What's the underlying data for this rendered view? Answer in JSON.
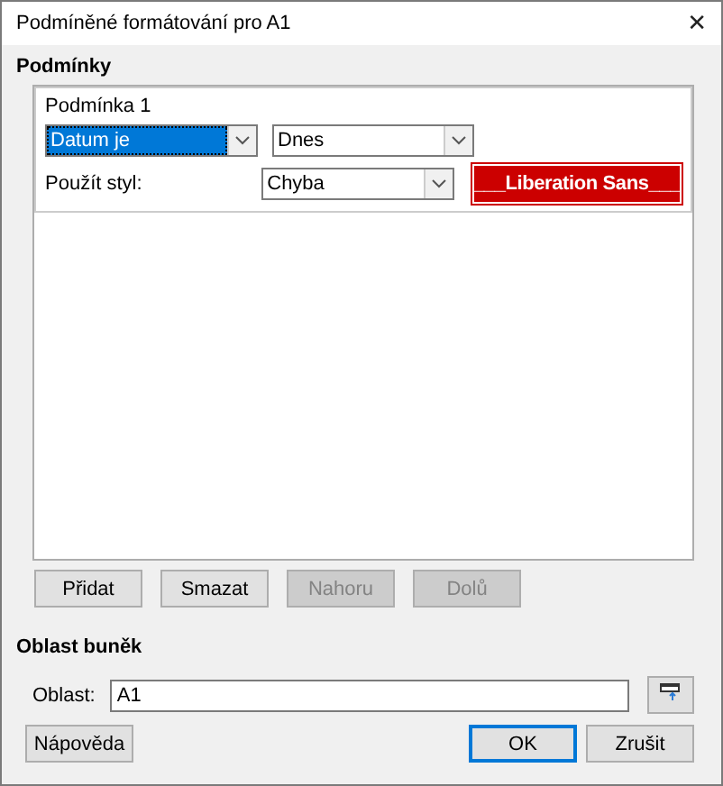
{
  "window": {
    "title": "Podmíněné formátování pro A1",
    "close": "✕"
  },
  "conditions_section": {
    "title": "Podmínky",
    "conditions": [
      {
        "label": "Podmínka 1",
        "type": {
          "value": "Datum je",
          "focused": true
        },
        "date": {
          "value": "Dnes"
        },
        "style_label": "Použít styl:",
        "style": {
          "value": "Chyba"
        },
        "preview": "___Liberation Sans___"
      }
    ],
    "buttons": [
      {
        "label": "Přidat",
        "disabled": false
      },
      {
        "label": "Smazat",
        "disabled": false
      },
      {
        "label": "Nahoru",
        "disabled": true
      },
      {
        "label": "Dolů",
        "disabled": true
      }
    ]
  },
  "range_section": {
    "title": "Oblast buněk",
    "label": "Oblast:",
    "value": "A1"
  },
  "footer": {
    "help": "Nápověda",
    "buttons": [
      {
        "label": "OK",
        "default": true
      },
      {
        "label": "Zrušit",
        "default": false
      }
    ]
  }
}
